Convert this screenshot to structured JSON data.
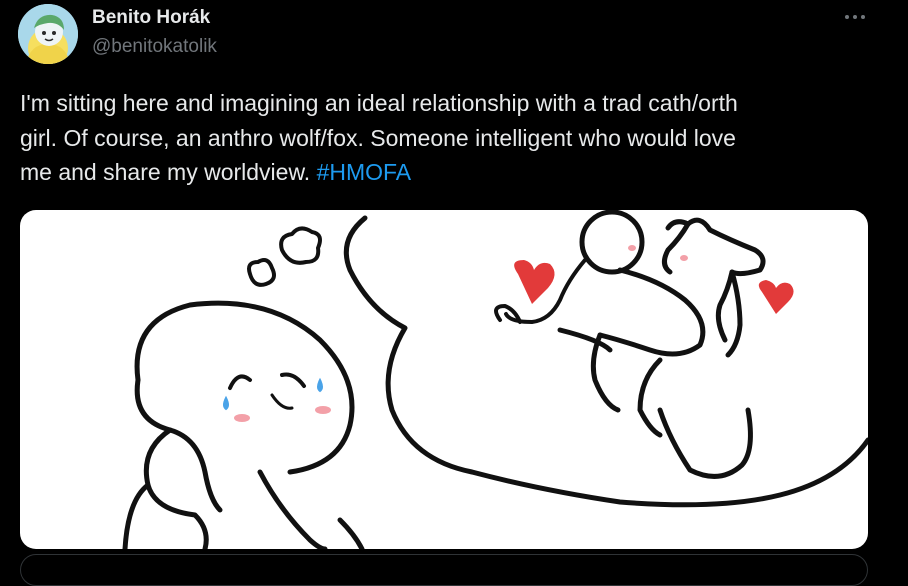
{
  "post": {
    "author": {
      "display_name": "Benito Horák",
      "handle": "@benitokatolik",
      "avatar_icon": "cartoon-avatar-icon"
    },
    "more_icon": "more-options-icon",
    "text_lines": [
      "I'm sitting here and imagining an ideal relationship with a trad cath/orth",
      "girl. Of course, an anthro wolf/fox. Someone intelligent who would love",
      "me and share my worldview. "
    ],
    "hashtag": "#HMOFA",
    "media": {
      "blush_text_left": "///",
      "blush_text_right": "////"
    }
  },
  "colors": {
    "background": "#000000",
    "text": "#e7e9ea",
    "secondary_text": "#71767b",
    "link": "#1d9bf0",
    "heart": "#e23a3a",
    "tear": "#4aa3e8",
    "blush": "#f3a0a8",
    "border": "#2f3336"
  }
}
